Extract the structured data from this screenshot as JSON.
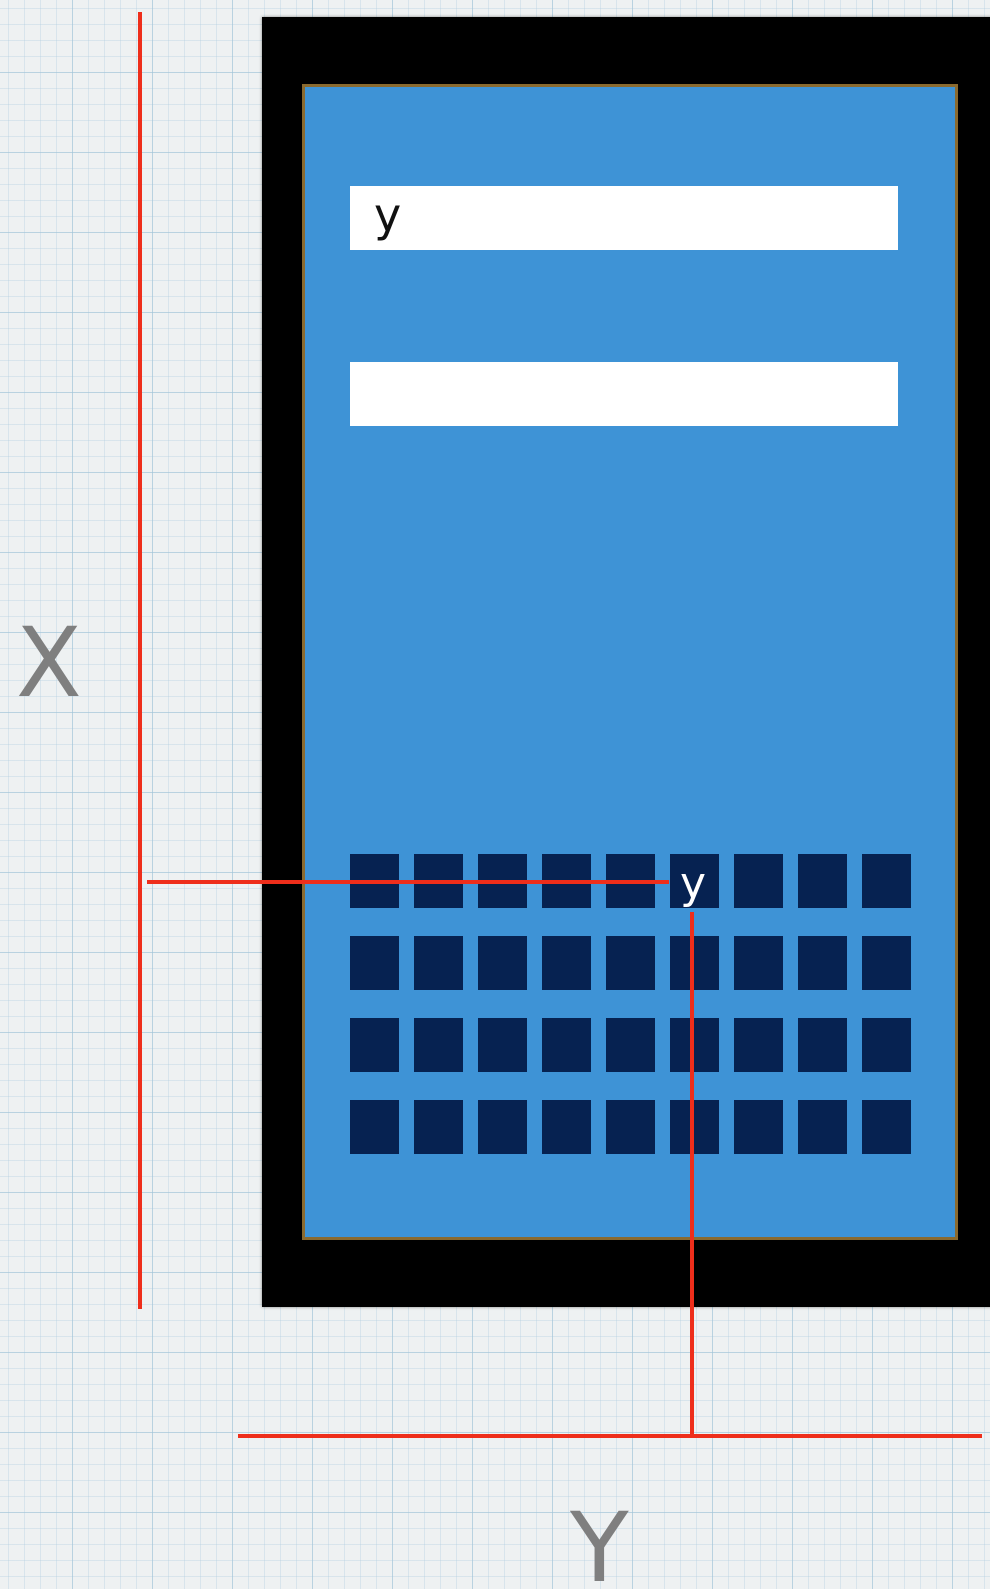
{
  "diagram": {
    "screen_color": "#3e93d6",
    "key_color": "#062251",
    "line_color": "#ee2e1b",
    "input_fields": [
      {
        "text": "y"
      },
      {
        "text": ""
      }
    ],
    "keyboard": {
      "rows": 4,
      "columns": 9
    },
    "marker_label": "y",
    "axis_labels": {
      "x": "X",
      "y": "Y"
    }
  }
}
